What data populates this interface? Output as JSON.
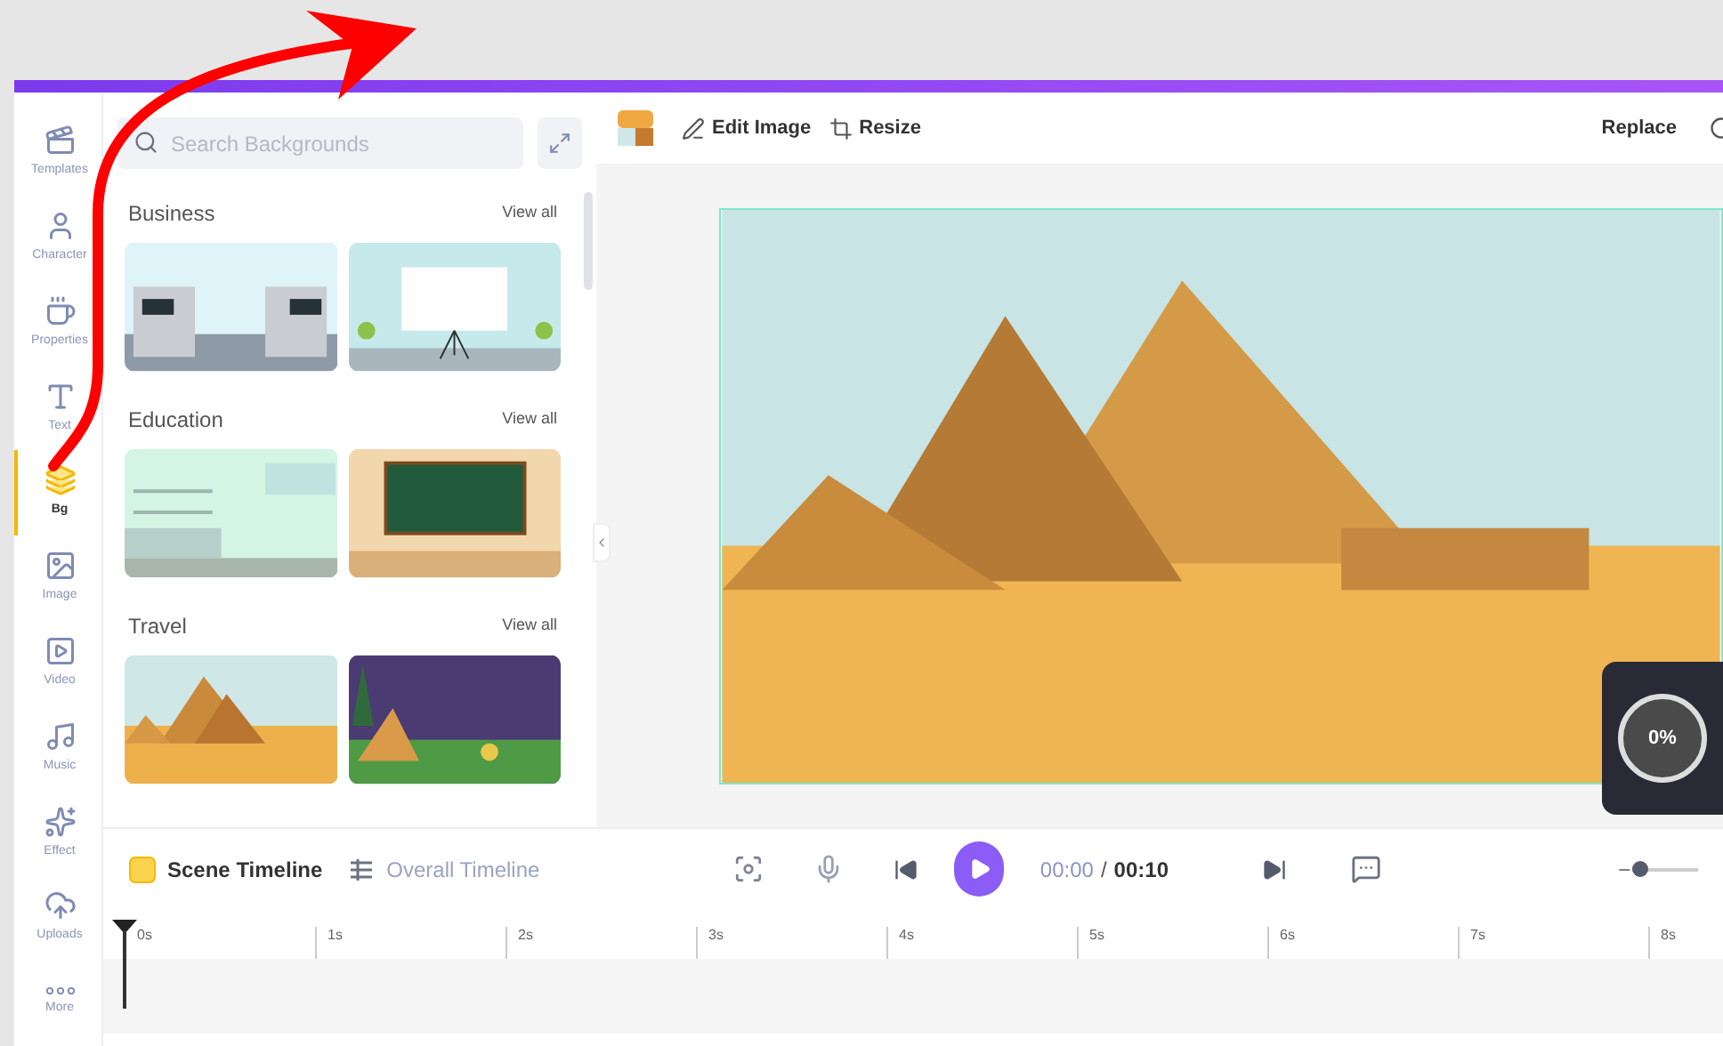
{
  "sidebar": {
    "items": [
      {
        "label": "Templates",
        "selected": false
      },
      {
        "label": "Character",
        "selected": false
      },
      {
        "label": "Properties",
        "selected": false
      },
      {
        "label": "Text",
        "selected": false
      },
      {
        "label": "Bg",
        "selected": true
      },
      {
        "label": "Image",
        "selected": false
      },
      {
        "label": "Video",
        "selected": false
      },
      {
        "label": "Music",
        "selected": false
      },
      {
        "label": "Effect",
        "selected": false
      },
      {
        "label": "Uploads",
        "selected": false
      },
      {
        "label": "More",
        "selected": false
      }
    ]
  },
  "panel": {
    "search": {
      "placeholder": "Search Backgrounds"
    },
    "sections": [
      {
        "title": "Business",
        "link": "View all",
        "thumbnails": [
          {
            "kind": "office"
          },
          {
            "kind": "presentation"
          }
        ]
      },
      {
        "title": "Education",
        "link": "View all",
        "thumbnails": [
          {
            "kind": "lab"
          },
          {
            "kind": "classroom"
          }
        ]
      },
      {
        "title": "Travel",
        "link": "View all",
        "thumbnails": [
          {
            "kind": "desert"
          },
          {
            "kind": "camp"
          }
        ]
      }
    ]
  },
  "toolbar": {
    "edit_image": "Edit Image",
    "resize": "Resize",
    "replace": "Replace"
  },
  "loading": {
    "progress": "0%"
  },
  "timeline": {
    "tabs": [
      {
        "label": "Scene Timeline",
        "selected": true
      },
      {
        "label": "Overall Timeline",
        "selected": false
      }
    ],
    "current_time": "00:00",
    "separator": "/",
    "total_time": "00:10",
    "zoom": {
      "level": 0.05
    },
    "ticks": [
      "0s",
      "1s",
      "2s",
      "3s",
      "4s",
      "5s",
      "6s",
      "7s",
      "8s"
    ]
  }
}
